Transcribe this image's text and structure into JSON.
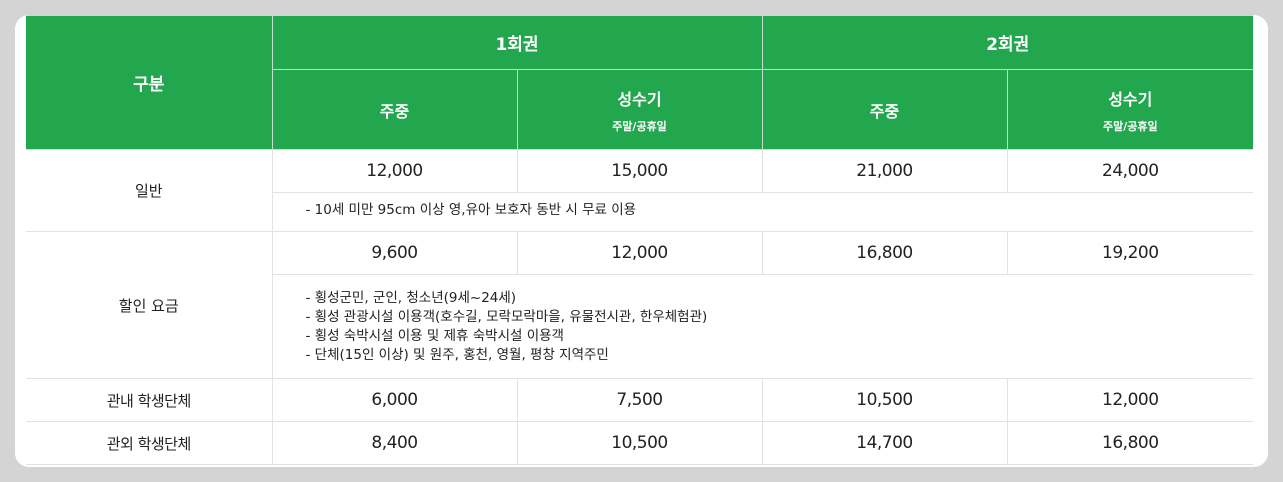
{
  "header": {
    "category": "구분",
    "group1": "1회권",
    "group2": "2회권",
    "weekday": "주중",
    "peak": "성수기",
    "peak_sub": "주말/공휴일"
  },
  "rows": {
    "general": {
      "label": "일반",
      "values": [
        "12,000",
        "15,000",
        "21,000",
        "24,000"
      ],
      "notes": [
        "- 10세 미만 95cm 이상 영,유아 보호자 동반 시 무료 이용"
      ]
    },
    "discount": {
      "label": "할인 요금",
      "values": [
        "9,600",
        "12,000",
        "16,800",
        "19,200"
      ],
      "notes": [
        "- 횡성군민, 군인, 청소년(9세~24세)",
        "- 횡성 관광시설 이용객(호수길, 모락모락마을, 유물전시관, 한우체험관)",
        "- 횡성 숙박시설 이용 및 제휴 숙박시설 이용객",
        "- 단체(15인 이상) 및 원주, 홍천, 영월, 평창 지역주민"
      ]
    },
    "student_in": {
      "label": "관내 학생단체",
      "values": [
        "6,000",
        "7,500",
        "10,500",
        "12,000"
      ]
    },
    "student_out": {
      "label": "관외 학생단체",
      "values": [
        "8,400",
        "10,500",
        "14,700",
        "16,800"
      ]
    }
  },
  "colors": {
    "header_bg": "#22a64e",
    "header_text": "#ffffff",
    "page_bg": "#d4d4d4"
  }
}
